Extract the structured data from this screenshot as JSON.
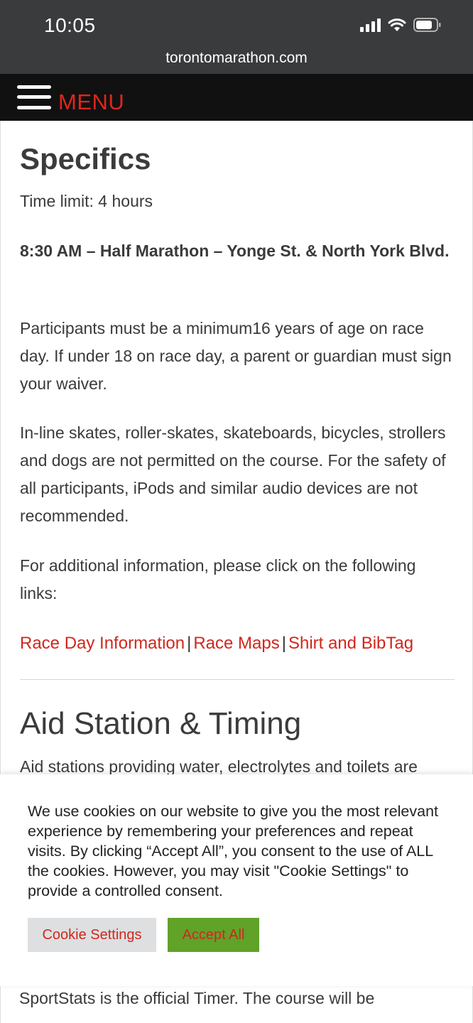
{
  "status_bar": {
    "time": "10:05",
    "url": "torontomarathon.com",
    "icons": [
      "signal-icon",
      "wifi-icon",
      "battery-icon"
    ]
  },
  "nav": {
    "menu_label": "MENU",
    "menu_icon": "hamburger-icon"
  },
  "specifics": {
    "heading": "Specifics",
    "time_limit": "Time limit: 4 hours",
    "start_info": "8:30 AM – Half Marathon – Yonge St. & North York Blvd.",
    "age_rule": "Participants must be a minimum16 years of age on race day. If under 18 on race day, a parent or guardian must sign your waiver.",
    "equipment_rule": "In-line skates, roller-skates, skateboards, bicycles, strollers and dogs are not permitted on the course. For the safety of all participants, iPods and similar audio devices are not recommended.",
    "more_info": "For additional information, please click on the following links:",
    "links": [
      "Race Day Information",
      "Race Maps",
      "Shirt and BibTag"
    ],
    "link_separator": "|"
  },
  "aid": {
    "heading": "Aid Station & Timing",
    "intro": "Aid stations providing water, electrolytes and toilets are",
    "timer_text": "SportStats is the official Timer. The course will be"
  },
  "cookie_banner": {
    "text": "We use cookies on our website to give you the most relevant experience by remembering your preferences and repeat visits. By clicking “Accept All”, you consent to the use of ALL the cookies. However, you may visit \"Cookie Settings\" to provide a controlled consent.",
    "settings_label": "Cookie Settings",
    "accept_label": "Accept All"
  },
  "colors": {
    "brand_red": "#d0271d",
    "accept_green": "#61a229",
    "menu_bar": "#111111",
    "status_bar": "#3a3b3c"
  }
}
